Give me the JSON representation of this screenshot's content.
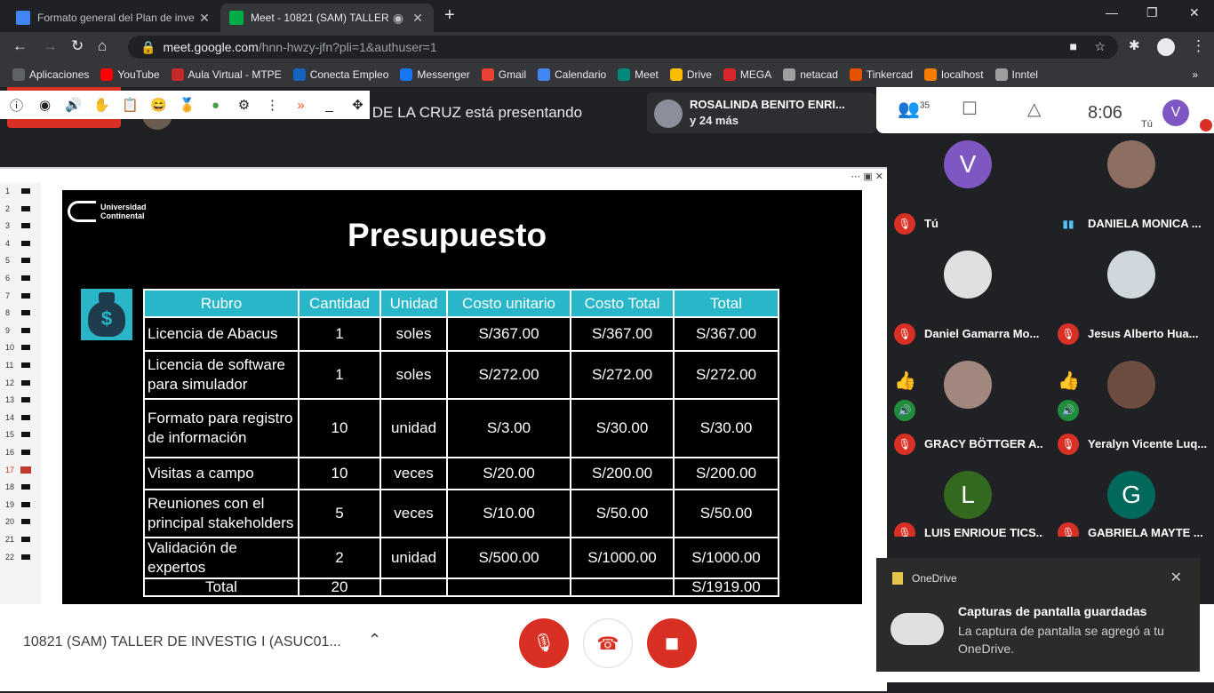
{
  "browser": {
    "tabs": [
      {
        "title": "Formato general del Plan de inve",
        "color": "#4285f4"
      },
      {
        "title": "Meet - 10821 (SAM) TALLER",
        "color": "#00ac47"
      }
    ],
    "url_host": "meet.google.com",
    "url_path": "/hnn-hwzy-jfn?pli=1&authuser=1",
    "bookmarks": [
      {
        "label": "Aplicaciones",
        "color": "#5f6368"
      },
      {
        "label": "YouTube",
        "color": "#ff0000"
      },
      {
        "label": "Aula Virtual - MTPE",
        "color": "#c62828"
      },
      {
        "label": "Conecta Empleo",
        "color": "#1565c0"
      },
      {
        "label": "Messenger",
        "color": "#1877f2"
      },
      {
        "label": "Gmail",
        "color": "#ea4335"
      },
      {
        "label": "Calendario",
        "color": "#4285f4"
      },
      {
        "label": "Meet",
        "color": "#00897b"
      },
      {
        "label": "Drive",
        "color": "#fbbc04"
      },
      {
        "label": "MEGA",
        "color": "#d9272e"
      },
      {
        "label": "netacad",
        "color": "#9e9e9e"
      },
      {
        "label": "Tinkercad",
        "color": "#e65100"
      },
      {
        "label": "localhost",
        "color": "#f57c00"
      },
      {
        "label": "Inntel",
        "color": "#9e9e9e"
      }
    ]
  },
  "meet": {
    "presenting_text": "VI DE LA CRUZ está presentando",
    "presenter_card": {
      "name": "ROSALINDA BENITO ENRI...",
      "more": "y 24 más"
    },
    "participant_count": "35",
    "clock": "8:06",
    "me_initial": "V",
    "me_label": "Tú",
    "meeting_title": "10821 (SAM) TALLER DE INVESTIG I (ASUC01...",
    "participants": [
      {
        "name": "Tú",
        "initial": "V",
        "color": "#7e57c2"
      },
      {
        "name": "DANIELA MONICA ...",
        "initial": "",
        "color": "#8d6e63"
      },
      {
        "name": "Daniel Gamarra Mo...",
        "initial": "",
        "color": "#e0e0e0"
      },
      {
        "name": "Jesus Alberto Hua...",
        "initial": "",
        "color": "#cfd8dc"
      },
      {
        "name": "GRACY BÖTTGER A...",
        "initial": "",
        "color": "#a1887f"
      },
      {
        "name": "Yeralyn Vicente Luq...",
        "initial": "",
        "color": "#6d4c41"
      },
      {
        "name": "LUIS ENRIQUE TICS...",
        "initial": "L",
        "color": "#33691e"
      },
      {
        "name": "GABRIELA MAYTE ...",
        "initial": "G",
        "color": "#00695c"
      }
    ]
  },
  "slide": {
    "logo": [
      "Universidad",
      "Continental"
    ],
    "title": "Presupuesto",
    "headers": [
      "Rubro",
      "Cantidad",
      "Unidad",
      "Costo unitario",
      "Costo Total",
      "Total"
    ],
    "rows": [
      [
        "Licencia de Abacus",
        "1",
        "soles",
        "S/367.00",
        "S/367.00",
        "S/367.00"
      ],
      [
        "Licencia de software para simulador",
        "1",
        "soles",
        "S/272.00",
        "S/272.00",
        "S/272.00"
      ],
      [
        "Formato para registro de información",
        "10",
        "unidad",
        "S/3.00",
        "S/30.00",
        "S/30.00"
      ],
      [
        "Visitas a campo",
        "10",
        "veces",
        "S/20.00",
        "S/200.00",
        "S/200.00"
      ],
      [
        "Reuniones con el principal stakeholders",
        "5",
        "veces",
        "S/10.00",
        "S/50.00",
        "S/50.00"
      ],
      [
        "Validación de expertos",
        "2",
        "unidad",
        "S/500.00",
        "S/1000.00",
        "S/1000.00"
      ]
    ],
    "total_row": [
      "Total",
      "20",
      "",
      "",
      "",
      "S/1919.00"
    ],
    "slide_numbers": [
      "1",
      "2",
      "3",
      "4",
      "5",
      "6",
      "7",
      "8",
      "9",
      "10",
      "11",
      "12",
      "13",
      "14",
      "15",
      "16",
      "17",
      "18",
      "19",
      "20",
      "21",
      "22"
    ],
    "current_slide": "17"
  },
  "toast": {
    "app": "OneDrive",
    "heading": "Capturas de pantalla guardadas",
    "body": "La captura de pantalla se agregó a tu OneDrive."
  }
}
